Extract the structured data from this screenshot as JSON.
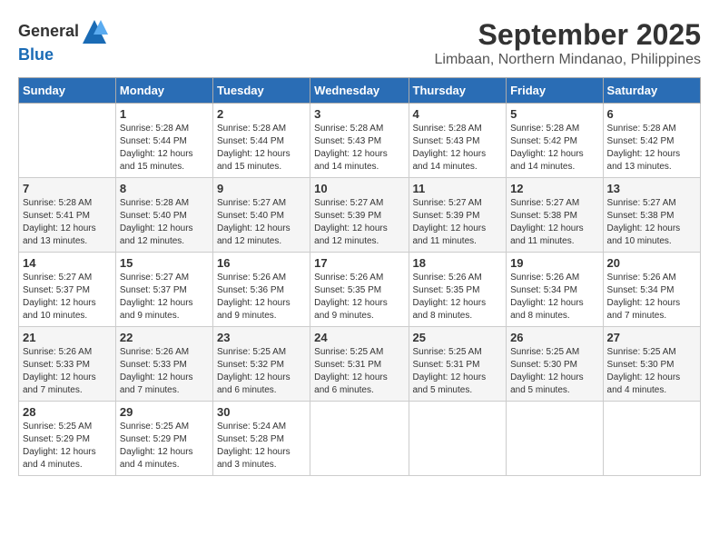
{
  "header": {
    "logo_line1": "General",
    "logo_line2": "Blue",
    "month": "September 2025",
    "location": "Limbaan, Northern Mindanao, Philippines"
  },
  "weekdays": [
    "Sunday",
    "Monday",
    "Tuesday",
    "Wednesday",
    "Thursday",
    "Friday",
    "Saturday"
  ],
  "weeks": [
    [
      {
        "day": "",
        "info": ""
      },
      {
        "day": "1",
        "info": "Sunrise: 5:28 AM\nSunset: 5:44 PM\nDaylight: 12 hours\nand 15 minutes."
      },
      {
        "day": "2",
        "info": "Sunrise: 5:28 AM\nSunset: 5:44 PM\nDaylight: 12 hours\nand 15 minutes."
      },
      {
        "day": "3",
        "info": "Sunrise: 5:28 AM\nSunset: 5:43 PM\nDaylight: 12 hours\nand 14 minutes."
      },
      {
        "day": "4",
        "info": "Sunrise: 5:28 AM\nSunset: 5:43 PM\nDaylight: 12 hours\nand 14 minutes."
      },
      {
        "day": "5",
        "info": "Sunrise: 5:28 AM\nSunset: 5:42 PM\nDaylight: 12 hours\nand 14 minutes."
      },
      {
        "day": "6",
        "info": "Sunrise: 5:28 AM\nSunset: 5:42 PM\nDaylight: 12 hours\nand 13 minutes."
      }
    ],
    [
      {
        "day": "7",
        "info": "Sunrise: 5:28 AM\nSunset: 5:41 PM\nDaylight: 12 hours\nand 13 minutes."
      },
      {
        "day": "8",
        "info": "Sunrise: 5:28 AM\nSunset: 5:40 PM\nDaylight: 12 hours\nand 12 minutes."
      },
      {
        "day": "9",
        "info": "Sunrise: 5:27 AM\nSunset: 5:40 PM\nDaylight: 12 hours\nand 12 minutes."
      },
      {
        "day": "10",
        "info": "Sunrise: 5:27 AM\nSunset: 5:39 PM\nDaylight: 12 hours\nand 12 minutes."
      },
      {
        "day": "11",
        "info": "Sunrise: 5:27 AM\nSunset: 5:39 PM\nDaylight: 12 hours\nand 11 minutes."
      },
      {
        "day": "12",
        "info": "Sunrise: 5:27 AM\nSunset: 5:38 PM\nDaylight: 12 hours\nand 11 minutes."
      },
      {
        "day": "13",
        "info": "Sunrise: 5:27 AM\nSunset: 5:38 PM\nDaylight: 12 hours\nand 10 minutes."
      }
    ],
    [
      {
        "day": "14",
        "info": "Sunrise: 5:27 AM\nSunset: 5:37 PM\nDaylight: 12 hours\nand 10 minutes."
      },
      {
        "day": "15",
        "info": "Sunrise: 5:27 AM\nSunset: 5:37 PM\nDaylight: 12 hours\nand 9 minutes."
      },
      {
        "day": "16",
        "info": "Sunrise: 5:26 AM\nSunset: 5:36 PM\nDaylight: 12 hours\nand 9 minutes."
      },
      {
        "day": "17",
        "info": "Sunrise: 5:26 AM\nSunset: 5:35 PM\nDaylight: 12 hours\nand 9 minutes."
      },
      {
        "day": "18",
        "info": "Sunrise: 5:26 AM\nSunset: 5:35 PM\nDaylight: 12 hours\nand 8 minutes."
      },
      {
        "day": "19",
        "info": "Sunrise: 5:26 AM\nSunset: 5:34 PM\nDaylight: 12 hours\nand 8 minutes."
      },
      {
        "day": "20",
        "info": "Sunrise: 5:26 AM\nSunset: 5:34 PM\nDaylight: 12 hours\nand 7 minutes."
      }
    ],
    [
      {
        "day": "21",
        "info": "Sunrise: 5:26 AM\nSunset: 5:33 PM\nDaylight: 12 hours\nand 7 minutes."
      },
      {
        "day": "22",
        "info": "Sunrise: 5:26 AM\nSunset: 5:33 PM\nDaylight: 12 hours\nand 7 minutes."
      },
      {
        "day": "23",
        "info": "Sunrise: 5:25 AM\nSunset: 5:32 PM\nDaylight: 12 hours\nand 6 minutes."
      },
      {
        "day": "24",
        "info": "Sunrise: 5:25 AM\nSunset: 5:31 PM\nDaylight: 12 hours\nand 6 minutes."
      },
      {
        "day": "25",
        "info": "Sunrise: 5:25 AM\nSunset: 5:31 PM\nDaylight: 12 hours\nand 5 minutes."
      },
      {
        "day": "26",
        "info": "Sunrise: 5:25 AM\nSunset: 5:30 PM\nDaylight: 12 hours\nand 5 minutes."
      },
      {
        "day": "27",
        "info": "Sunrise: 5:25 AM\nSunset: 5:30 PM\nDaylight: 12 hours\nand 4 minutes."
      }
    ],
    [
      {
        "day": "28",
        "info": "Sunrise: 5:25 AM\nSunset: 5:29 PM\nDaylight: 12 hours\nand 4 minutes."
      },
      {
        "day": "29",
        "info": "Sunrise: 5:25 AM\nSunset: 5:29 PM\nDaylight: 12 hours\nand 4 minutes."
      },
      {
        "day": "30",
        "info": "Sunrise: 5:24 AM\nSunset: 5:28 PM\nDaylight: 12 hours\nand 3 minutes."
      },
      {
        "day": "",
        "info": ""
      },
      {
        "day": "",
        "info": ""
      },
      {
        "day": "",
        "info": ""
      },
      {
        "day": "",
        "info": ""
      }
    ]
  ]
}
